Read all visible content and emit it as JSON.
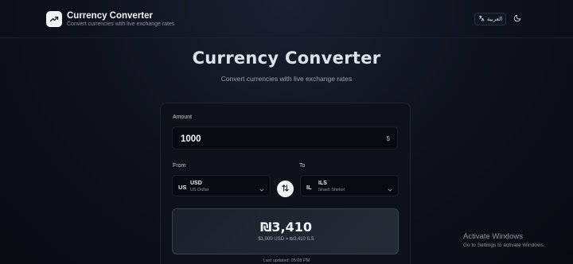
{
  "header": {
    "app_title": "Currency Converter",
    "app_subtitle": "Convert currencies with live exchange rates",
    "logo_icon": "trending-up-icon",
    "language_button": "العربية",
    "language_icon": "translate-icon",
    "theme_icon": "moon-icon"
  },
  "hero": {
    "title": "Currency Converter",
    "subtitle": "Convert currencies with live exchange rates"
  },
  "converter": {
    "amount_label": "Amount",
    "amount_value": "1000",
    "amount_suffix": "$",
    "from_label": "From",
    "to_label": "To",
    "from": {
      "flag": "US",
      "code": "USD",
      "name": "US Dollar"
    },
    "to": {
      "flag": "IL",
      "code": "ILS",
      "name": "Israeli Shekel"
    },
    "swap_icon": "swap-vertical-icon",
    "result_value": "₪3,410",
    "result_detail": "$1,000 USD = ₪3,410 ILS",
    "last_updated": "Last updated: 05:08 PM"
  },
  "watermark": {
    "title": "Activate Windows",
    "subtitle": "Go to Settings to activate Windows."
  },
  "colors": {
    "background": "#0c111b",
    "card": "#0c111a",
    "accent": "#f2f4f7"
  }
}
